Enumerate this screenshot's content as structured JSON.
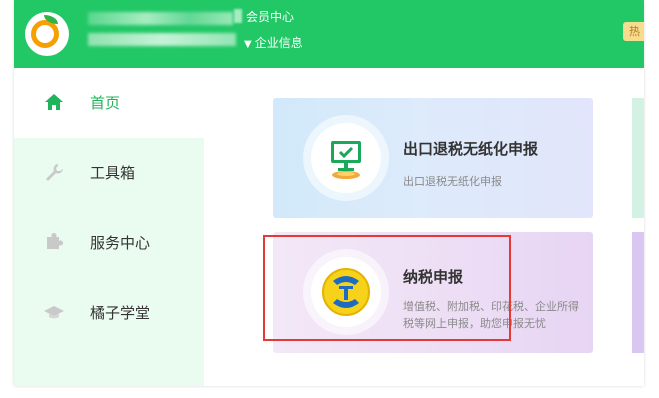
{
  "header": {
    "member_center": "会员中心",
    "company_info": "企业信息",
    "caret": "▼",
    "hot_badge": "热"
  },
  "sidebar": {
    "items": [
      {
        "label": "首页",
        "icon": "home-icon",
        "active": true
      },
      {
        "label": "工具箱",
        "icon": "wrench-icon",
        "active": false
      },
      {
        "label": "服务中心",
        "icon": "puzzle-icon",
        "active": false
      },
      {
        "label": "橘子学堂",
        "icon": "graduation-cap-icon",
        "active": false
      }
    ]
  },
  "cards": [
    {
      "title": "出口退税无纸化申报",
      "subtitle": "出口退税无纸化申报",
      "icon": "monitor-check-icon"
    },
    {
      "title": "纳税申报",
      "subtitle": "增值税、附加税、印花税、企业所得税等网上申报，助您申报无忧",
      "icon": "tax-logo-icon"
    }
  ],
  "colors": {
    "brand_green": "#22c766",
    "sidebar_bg": "#eafbf0",
    "active_text": "#1fb35a",
    "highlight_red": "#e53935"
  }
}
